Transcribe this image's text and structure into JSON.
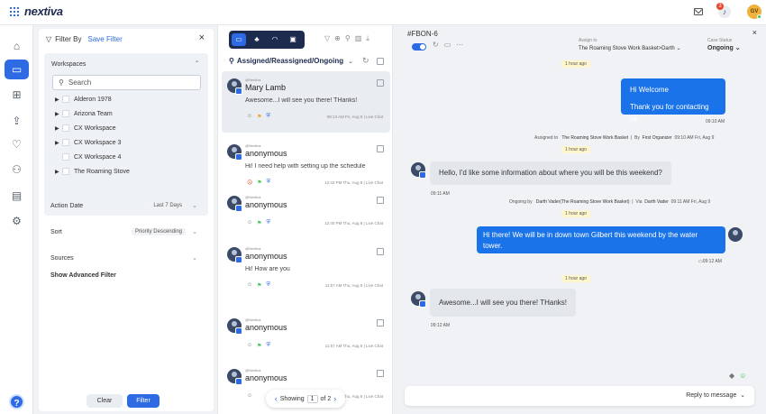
{
  "header": {
    "logo_text": "nextiva",
    "notification_count": "3",
    "user_initials": "GV"
  },
  "nav": [
    {
      "name": "home-icon",
      "glyph": "⌂"
    },
    {
      "name": "inbox-icon",
      "glyph": "▭",
      "active": true
    },
    {
      "name": "apps-grid-icon",
      "glyph": "⊞"
    },
    {
      "name": "upload-icon",
      "glyph": "⇪"
    },
    {
      "name": "heart-icon",
      "glyph": "♡"
    },
    {
      "name": "team-icon",
      "glyph": "⚇"
    },
    {
      "name": "report-icon",
      "glyph": "▤"
    },
    {
      "name": "settings-icon",
      "glyph": "⚙"
    }
  ],
  "filter_panel": {
    "title": "Filter By",
    "save_filter": "Save Filter",
    "workspaces_label": "Workspaces",
    "search_placeholder": "Search",
    "workspaces": [
      {
        "label": "Alderon 1978",
        "expandable": true
      },
      {
        "label": "Arizona Team",
        "expandable": true
      },
      {
        "label": "CX Workspace",
        "expandable": true
      },
      {
        "label": "CX Workspace 3",
        "expandable": true
      },
      {
        "label": "CX Workspace 4",
        "expandable": false
      },
      {
        "label": "The Roaming Stove",
        "expandable": true
      }
    ],
    "action_date_label": "Action Date",
    "action_date_value": "Last 7 Days",
    "sort_label": "Sort",
    "sort_value": "Priority Descending",
    "sources_label": "Sources",
    "advanced_filter": "Show Advanced Filter",
    "clear_button": "Clear",
    "filter_button": "Filter"
  },
  "conversations": {
    "view_filter": "Assigned/Reassigned/Ongoing",
    "items": [
      {
        "source": "@Nextiva",
        "name": "Mary Lamb",
        "message": "Awesome...I will see you there! THanks!",
        "time": "09:13 AM Fri, Aug 9 | Live Chat",
        "active": true,
        "has_message": true
      },
      {
        "source": "@Nextiva",
        "name": "anonymous",
        "message": "Hi! I need help with setting up the schedule",
        "time": "12:43 PM Thu, Aug 8 | Live Chat",
        "active": false,
        "has_message": true
      },
      {
        "source": "@Nextiva",
        "name": "anonymous",
        "message": "",
        "time": "12:40 PM Thu, Aug 8 | Live Chat",
        "active": false,
        "has_message": false
      },
      {
        "source": "@Nextiva",
        "name": "anonymous",
        "message": "Hi! How are you",
        "time": "11:57 AM Thu, Aug 8 | Live Chat",
        "active": false,
        "has_message": true
      },
      {
        "source": "@Nextiva",
        "name": "anonymous",
        "message": "",
        "time": "11:57 AM Thu, Aug 8 | Live Chat",
        "active": false,
        "has_message": false
      },
      {
        "source": "@Nextiva",
        "name": "anonymous",
        "message": "",
        "time": "11:56 AM Thu, Aug 8 | Live Chat",
        "active": false,
        "has_message": false
      }
    ],
    "pager": {
      "showing": "Showing",
      "page": "1",
      "of": "of 2"
    }
  },
  "chat": {
    "ticket_id": "#FBON-6",
    "assign_label": "Assign to",
    "assign_value": "The Roaming Stove Work Basket>Darth",
    "status_label": "Case Status",
    "status_value": "Ongoing",
    "chip_1": "1 hour ago",
    "out_msg_1_line1": "Hi Welcome",
    "out_msg_1_line2": "Thank you for contacting us.",
    "ts_1": "09:10 AM",
    "sys_1_pre": "Assigned to",
    "sys_1_target": "The Roaming Stove Work Basket",
    "sys_1_by": "By",
    "sys_1_agent": "First Organizer",
    "sys_1_time": "09:10 AM Fri, Aug 9",
    "chip_2": "1 hour ago",
    "in_msg_1": "Hello, I'd like some information about where you will be this weekend?",
    "ts_2": "09:11 AM",
    "sys_2_pre": "Ongoing by",
    "sys_2_target": "Darth Vader(The Roaming Stove Work Basket)",
    "sys_2_via": "Via",
    "sys_2_agent": "Darth Vader",
    "sys_2_time": "09:11 AM Fri, Aug 9",
    "chip_3": "1 hour ago",
    "out_msg_2_line1": "Hi there! We will be in down town Gilbert this weekend by the water",
    "out_msg_2_line2": "tower.",
    "ts_3": "09:12 AM",
    "chip_4": "1 hour ago",
    "in_msg_2": "Awesome...I will see you there! THanks!",
    "ts_4": "09:12 AM",
    "reply_label": "Reply to message"
  },
  "colors": {
    "accent": "#2d6ae3",
    "dark": "#1d2b4f",
    "outgoing_bubble": "#1a73e8"
  }
}
